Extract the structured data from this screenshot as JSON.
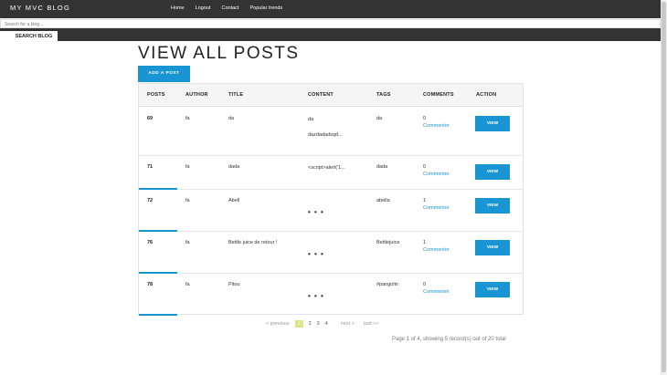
{
  "nav": {
    "brand": "MY MVC BLOG",
    "links": [
      "Home",
      "Logout",
      "Contact",
      "Popular trends"
    ]
  },
  "search": {
    "placeholder": "Search for a blog...",
    "button_label": "SEARCH BLOG"
  },
  "main": {
    "title": "VIEW ALL POSTS",
    "add_button": "ADD A POST"
  },
  "table": {
    "headers": [
      "POSTS",
      "AUTHOR",
      "TITLE",
      "CONTENT",
      "TAGS",
      "COMMENTS",
      "ACTION"
    ],
    "rows": [
      {
        "id": "69",
        "author": "fa",
        "title": "da",
        "content_line1": "da",
        "content_line2": "dazdadadsqd...",
        "tags": "da",
        "comments": "0",
        "commenter": "Commenter",
        "action": "VIEW"
      },
      {
        "id": "71",
        "author": "fa",
        "title": "dada",
        "content_line1": "<script>alert('1...",
        "content_line2": "",
        "tags": "dada",
        "comments": "0",
        "commenter": "Commenter",
        "action": "VIEW"
      },
      {
        "id": "72",
        "author": "fa",
        "title": "Abell",
        "content_line1": "• • •",
        "content_line2": "",
        "tags": "abella",
        "comments": "1",
        "commenter": "Commenter",
        "action": "VIEW"
      },
      {
        "id": "76",
        "author": "fa",
        "title": "Bettle juice de retour !",
        "content_line1": "• • •",
        "content_line2": "",
        "tags": "Bettlejuice",
        "comments": "1",
        "commenter": "Commenter",
        "action": "VIEW"
      },
      {
        "id": "78",
        "author": "fa",
        "title": "Pitou",
        "content_line1": "• • •",
        "content_line2": "",
        "tags": "#pangolin",
        "comments": "0",
        "commenter": "Commenter",
        "action": "VIEW"
      }
    ]
  },
  "pagination": {
    "previous": "< previous",
    "pages": [
      "1",
      "2",
      "3",
      "4"
    ],
    "current": "1",
    "next": "next >",
    "last": "last >>",
    "summary": "Page 1 of 4, showing 5 record(s) out of 20 total"
  },
  "colors": {
    "accent": "#1a95d3",
    "nav_bg": "#333333",
    "current_page": "#d9e68a"
  }
}
